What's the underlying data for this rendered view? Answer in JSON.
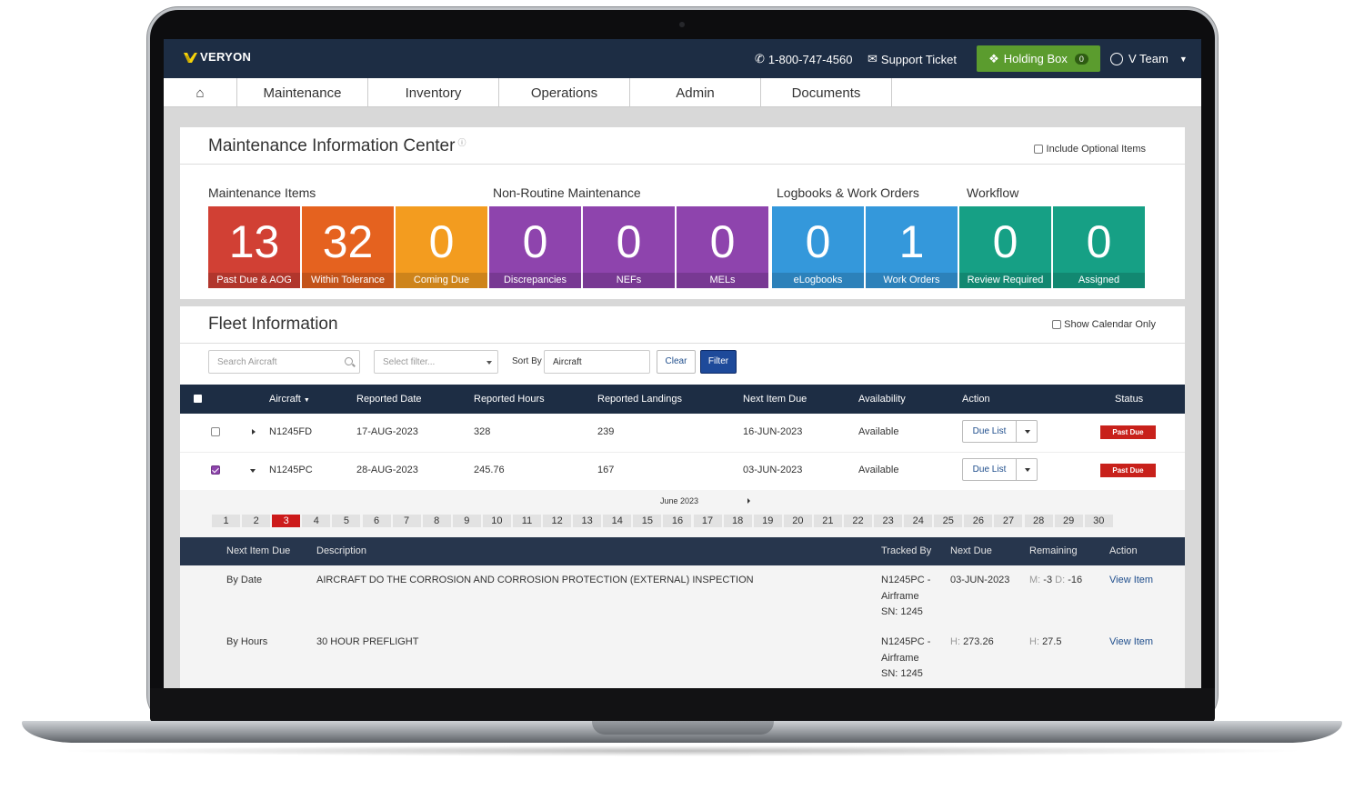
{
  "topbar": {
    "brand": "VERYON",
    "phone": "1-800-747-4560",
    "support_ticket": "Support Ticket",
    "holding_box": "Holding Box",
    "holding_count": "0",
    "user": "V Team"
  },
  "nav": {
    "tabs": [
      "Maintenance",
      "Inventory",
      "Operations",
      "Admin",
      "Documents"
    ]
  },
  "mic": {
    "title": "Maintenance Information Center",
    "include_optional": "Include Optional Items",
    "groups": [
      "Maintenance Items",
      "Non-Routine Maintenance",
      "Logbooks & Work Orders",
      "Workflow"
    ],
    "tiles": [
      {
        "value": "13",
        "label": "Past Due & AOG",
        "color": "#d14034"
      },
      {
        "value": "32",
        "label": "Within Tolerance",
        "color": "#e5621f"
      },
      {
        "value": "0",
        "label": "Coming Due",
        "color": "#f39c1f"
      },
      {
        "value": "0",
        "label": "Discrepancies",
        "color": "#8e44ad"
      },
      {
        "value": "0",
        "label": "NEFs",
        "color": "#8e44ad"
      },
      {
        "value": "0",
        "label": "MELs",
        "color": "#8e44ad"
      },
      {
        "value": "0",
        "label": "eLogbooks",
        "color": "#3498db"
      },
      {
        "value": "1",
        "label": "Work Orders",
        "color": "#3498db"
      },
      {
        "value": "0",
        "label": "Review Required",
        "color": "#16a085"
      },
      {
        "value": "0",
        "label": "Assigned",
        "color": "#16a085"
      }
    ]
  },
  "fleet": {
    "title": "Fleet Information",
    "show_calendar": "Show Calendar Only",
    "search_placeholder": "Search Aircraft",
    "filter_placeholder": "Select filter...",
    "sort_by_label": "Sort By",
    "sort_by_value": "Aircraft",
    "clear_label": "Clear",
    "filter_label": "Filter",
    "columns": [
      "Aircraft",
      "Reported Date",
      "Reported Hours",
      "Reported Landings",
      "Next Item Due",
      "Availability",
      "Action",
      "Status"
    ],
    "rows": [
      {
        "aircraft": "N1245FD",
        "reported_date": "17-AUG-2023",
        "reported_hours": "328",
        "reported_landings": "239",
        "next_item_due": "16-JUN-2023",
        "availability": "Available",
        "action": "Due List",
        "status": "Past Due",
        "checked": false
      },
      {
        "aircraft": "N1245PC",
        "reported_date": "28-AUG-2023",
        "reported_hours": "245.76",
        "reported_landings": "167",
        "next_item_due": "03-JUN-2023",
        "availability": "Available",
        "action": "Due List",
        "status": "Past Due",
        "checked": true
      }
    ],
    "calendar": {
      "month": "June 2023",
      "days": [
        "1",
        "2",
        "3",
        "4",
        "5",
        "6",
        "7",
        "8",
        "9",
        "10",
        "11",
        "12",
        "13",
        "14",
        "15",
        "16",
        "17",
        "18",
        "19",
        "20",
        "21",
        "22",
        "23",
        "24",
        "25",
        "26",
        "27",
        "28",
        "29",
        "30"
      ],
      "selected_day": "3"
    },
    "detail_columns": [
      "Next Item Due",
      "Description",
      "Tracked By",
      "Next Due",
      "Remaining",
      "Action"
    ],
    "detail_rows": [
      {
        "due_by": "By Date",
        "description": "AIRCRAFT DO THE CORROSION AND CORROSION PROTECTION (EXTERNAL) INSPECTION",
        "tracked_1": "N1245PC -",
        "tracked_2": "Airframe",
        "tracked_3": "SN: 1245",
        "next_due_prefix": "",
        "next_due": "03-JUN-2023",
        "rem_prefix_1": "M:",
        "rem_val_1": "-3",
        "rem_prefix_2": "D:",
        "rem_val_2": "-16",
        "action": "View Item"
      },
      {
        "due_by": "By Hours",
        "description": "30 HOUR PREFLIGHT",
        "tracked_1": "N1245PC -",
        "tracked_2": "Airframe",
        "tracked_3": "SN: 1245",
        "next_due_prefix": "H:",
        "next_due": "273.26",
        "rem_prefix_1": "H:",
        "rem_val_1": "27.5",
        "rem_prefix_2": "",
        "rem_val_2": "",
        "action": "View Item"
      }
    ]
  }
}
